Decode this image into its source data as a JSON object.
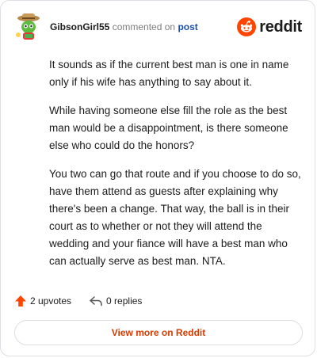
{
  "comment": {
    "username": "GibsonGirl55",
    "action_text": "commented on",
    "post_link": "post",
    "paragraphs": [
      "It sounds as if the current best man is one in name only if his wife has anything to say about it.",
      "While having someone else fill the role as the best man would be a disappointment, is there someone else who could do the honors?",
      "You two can go that route and if you choose to do so, have them attend as guests after explaining why there's been a change. That way, the ball is in their court as to whether or not they will attend the wedding and your fiance will have a best man who can actually serve as best man. NTA."
    ]
  },
  "brand": {
    "name": "reddit",
    "color": "#ff4500"
  },
  "stats": {
    "upvotes": "2 upvotes",
    "replies": "0 replies"
  },
  "footer": {
    "view_more": "View more on Reddit"
  },
  "colors": {
    "accent": "#ff4500",
    "link": "#1a4ea6",
    "button_text": "#d93a00"
  }
}
